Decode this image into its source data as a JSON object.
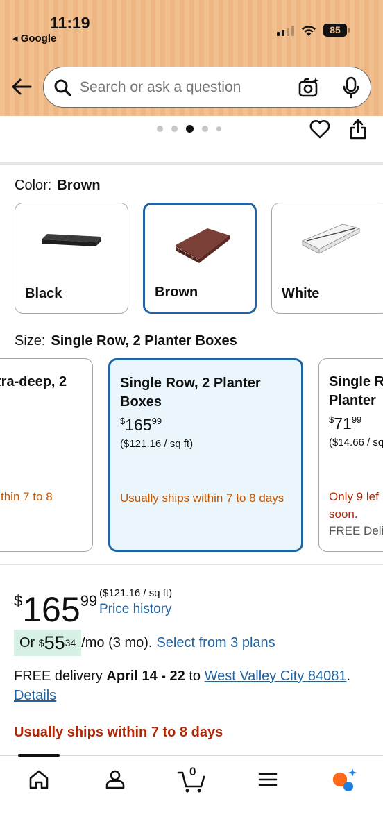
{
  "status_bar": {
    "time": "11:19",
    "back_app": "◂ Google",
    "battery": "85"
  },
  "search": {
    "placeholder": "Search or ask a question"
  },
  "carousel": {
    "dot_count": 5,
    "active_index": 2
  },
  "color_section": {
    "label": "Color:",
    "selected": "Brown",
    "options": [
      {
        "name": "Black",
        "color": "#222222"
      },
      {
        "name": "Brown",
        "color": "#5a2a22"
      },
      {
        "name": "White",
        "color": "#f0f0f0"
      }
    ]
  },
  "size_section": {
    "label": "Size:",
    "selected": "Single Row, 2 Planter Boxes",
    "cards": [
      {
        "title": "tra-deep, 2",
        "title2": "",
        "ship": "thin 7 to 8"
      },
      {
        "title": "Single Row, 2 Planter Boxes",
        "price_sym": "$",
        "price_whole": "165",
        "price_frac": "99",
        "unit": "($121.16 / sq ft)",
        "ship": "Usually ships within 7 to 8 days"
      },
      {
        "title": "Single R Planter",
        "price_sym": "$",
        "price_whole": "71",
        "price_frac": "99",
        "unit": "($14.66 / sq",
        "ship": "Only 9 lef soon.",
        "deliv": "FREE Deli"
      }
    ]
  },
  "price_block": {
    "currency": "$",
    "whole": "165",
    "fraction": "99",
    "unit_price": "($121.16 / sq ft)",
    "history_link": "Price history"
  },
  "monthly": {
    "prefix": "Or ",
    "currency": "$",
    "whole": "55",
    "fraction": "34",
    "suffix": "/mo (3 mo).",
    "plans_link": "Select from 3 plans"
  },
  "delivery": {
    "free_text": "FREE delivery ",
    "dates": "April 14 - 22",
    "to": " to ",
    "location": "West Valley City 84081",
    "period": ".",
    "details": "Details"
  },
  "shipping_notice": "Usually ships within 7 to 8 days",
  "bottom_nav": {
    "cart_count": "0",
    "items": [
      "home",
      "account",
      "cart",
      "menu",
      "rufus"
    ]
  },
  "colors": {
    "link": "#2162a1",
    "selected_border": "#2162a1",
    "ship_orange": "#c45500",
    "ship_red": "#b12704",
    "monthly_bg": "#d6f1e4"
  }
}
